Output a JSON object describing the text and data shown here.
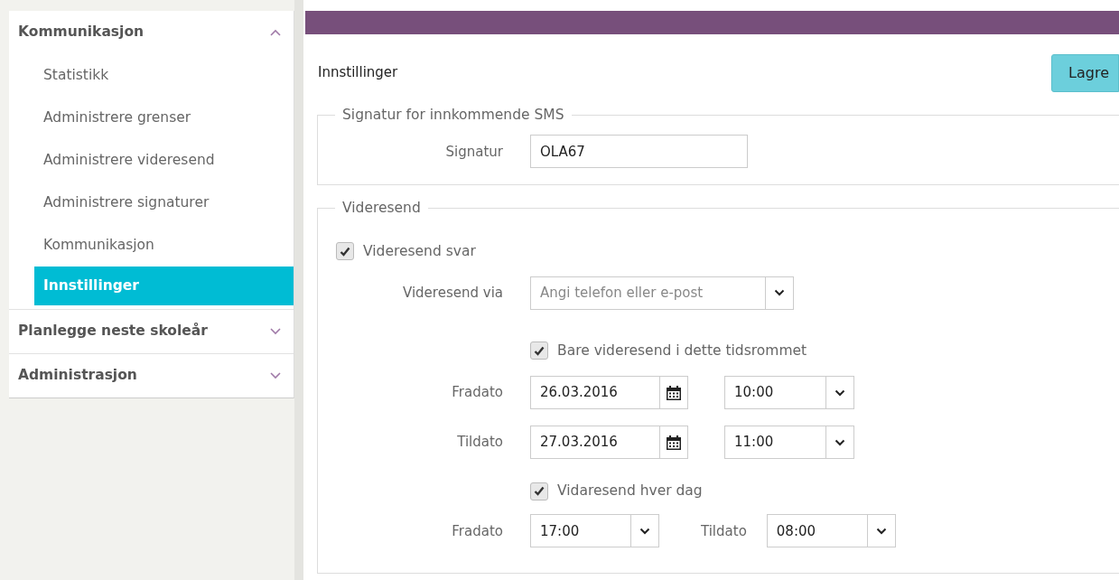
{
  "sidebar": {
    "groups": [
      {
        "label": "Kommunikasjon",
        "expanded": true,
        "children": [
          {
            "label": "Statistikk",
            "selected": false
          },
          {
            "label": "Administrere grenser",
            "selected": false
          },
          {
            "label": "Administrere videresend",
            "selected": false
          },
          {
            "label": "Administrere signaturer",
            "selected": false
          },
          {
            "label": "Kommunikasjon",
            "selected": false
          },
          {
            "label": "Innstillinger",
            "selected": true
          }
        ]
      },
      {
        "label": "Planlegge neste skoleår",
        "expanded": false
      },
      {
        "label": "Administrasjon",
        "expanded": false
      }
    ]
  },
  "header": {
    "title": "Innstillinger",
    "save_button": "Lagre"
  },
  "signature_section": {
    "legend": "Signatur for innkommende SMS",
    "label": "Signatur",
    "value": "OLA67"
  },
  "forward_section": {
    "legend": "Videresend",
    "forward_replies": {
      "label": "Videresend svar",
      "checked": true
    },
    "forward_via": {
      "label": "Videresend via",
      "placeholder": "Angi telefon eller e-post"
    },
    "period_only": {
      "label": "Bare videresend i dette tidsrommet",
      "checked": true
    },
    "from_date": {
      "label": "Fradato",
      "date": "26.03.2016",
      "time": "10:00"
    },
    "to_date": {
      "label": "Tildato",
      "date": "27.03.2016",
      "time": "11:00"
    },
    "daily": {
      "label": "Vidaresend hver dag",
      "checked": true
    },
    "daily_from": {
      "label": "Fradato",
      "time": "17:00"
    },
    "daily_to": {
      "label": "Tildato",
      "time": "08:00"
    }
  }
}
